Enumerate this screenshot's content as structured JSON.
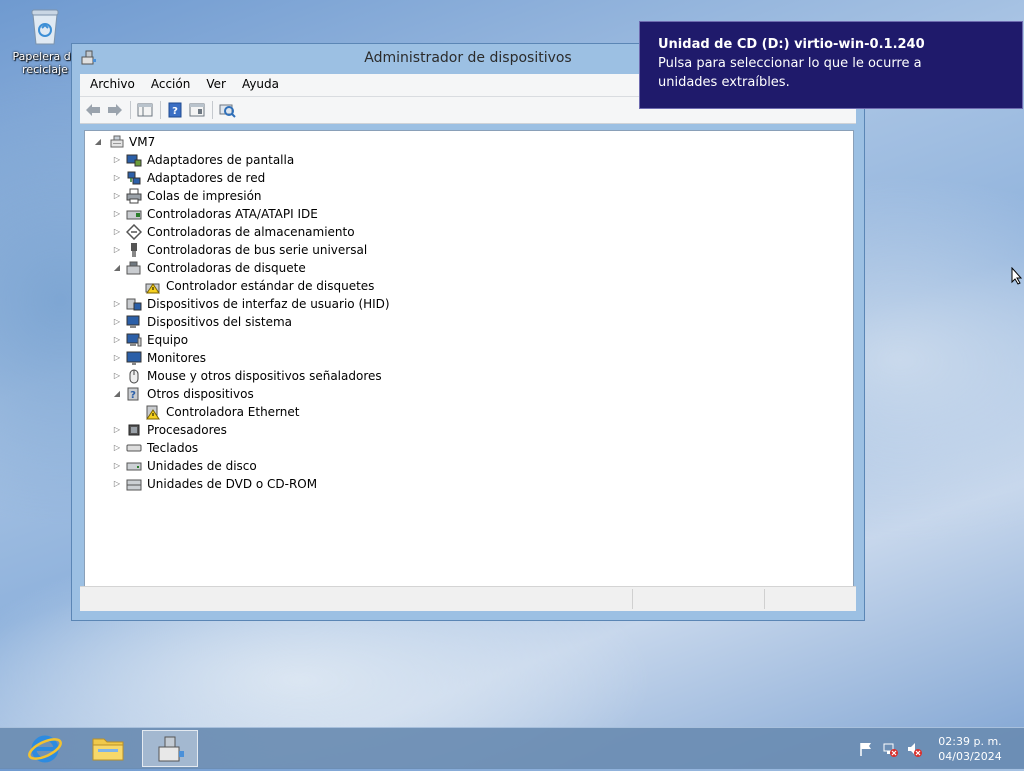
{
  "desktop": {
    "recycle_bin_label_1": "Papelera de",
    "recycle_bin_label_2": "reciclaje"
  },
  "window": {
    "title": "Administrador de dispositivos",
    "menu": [
      "Archivo",
      "Acción",
      "Ver",
      "Ayuda"
    ],
    "toolbar_icons": [
      "back-icon",
      "forward-icon",
      "show-hide-console-tree-icon",
      "help-icon",
      "properties-icon",
      "scan-hardware-icon"
    ]
  },
  "tree": {
    "root": "VM7",
    "items": [
      {
        "label": "Adaptadores de pantalla",
        "expanded": false,
        "icon": "display-adapter-icon"
      },
      {
        "label": "Adaptadores de red",
        "expanded": false,
        "icon": "network-adapter-icon"
      },
      {
        "label": "Colas de impresión",
        "expanded": false,
        "icon": "printer-icon"
      },
      {
        "label": "Controladoras ATA/ATAPI IDE",
        "expanded": false,
        "icon": "ide-controller-icon"
      },
      {
        "label": "Controladoras de almacenamiento",
        "expanded": false,
        "icon": "storage-controller-icon"
      },
      {
        "label": "Controladoras de bus serie universal",
        "expanded": false,
        "icon": "usb-icon"
      },
      {
        "label": "Controladoras de disquete",
        "expanded": true,
        "icon": "floppy-controller-icon"
      },
      {
        "label": "Controlador estándar de disquetes",
        "child": true,
        "warning": true,
        "icon": "floppy-warning-icon"
      },
      {
        "label": "Dispositivos de interfaz de usuario (HID)",
        "expanded": false,
        "icon": "hid-icon"
      },
      {
        "label": "Dispositivos del sistema",
        "expanded": false,
        "icon": "system-devices-icon"
      },
      {
        "label": "Equipo",
        "expanded": false,
        "icon": "computer-icon"
      },
      {
        "label": "Monitores",
        "expanded": false,
        "icon": "monitor-icon"
      },
      {
        "label": "Mouse y otros dispositivos señaladores",
        "expanded": false,
        "icon": "mouse-icon"
      },
      {
        "label": "Otros dispositivos",
        "expanded": true,
        "icon": "other-devices-icon"
      },
      {
        "label": "Controladora Ethernet",
        "child": true,
        "warning": true,
        "icon": "unknown-device-warning-icon"
      },
      {
        "label": "Procesadores",
        "expanded": false,
        "icon": "processor-icon"
      },
      {
        "label": "Teclados",
        "expanded": false,
        "icon": "keyboard-icon"
      },
      {
        "label": "Unidades de disco",
        "expanded": false,
        "icon": "disk-drive-icon"
      },
      {
        "label": "Unidades de DVD o CD-ROM",
        "expanded": false,
        "icon": "dvd-drive-icon"
      }
    ]
  },
  "toast": {
    "title": "Unidad de CD (D:) virtio-win-0.1.240",
    "line1": "Pulsa para seleccionar lo que le ocurre a",
    "line2": "unidades extraíbles."
  },
  "taskbar": {
    "apps": [
      "internet-explorer-icon",
      "file-explorer-icon",
      "device-manager-icon"
    ],
    "tray": [
      "action-center-flag-icon",
      "network-error-icon",
      "volume-muted-icon"
    ],
    "time": "02:39 p. m.",
    "date": "04/03/2024"
  },
  "colors": {
    "toast_bg": "#1f1a6b",
    "window_frame": "#9cc0e3",
    "taskbar": "#6a8cb2"
  }
}
